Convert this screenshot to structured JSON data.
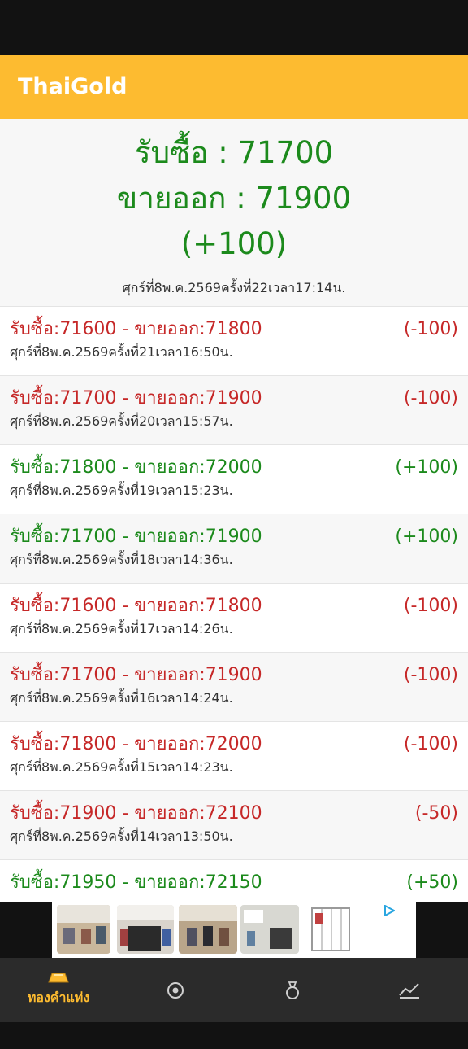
{
  "app": {
    "title": "ThaiGold"
  },
  "summary": {
    "buy_line": "รับซื้อ : 71700",
    "sell_line": "ขายออก : 71900",
    "change": "(+100)",
    "date": "ศุกร์ที่8พ.ค.2569ครั้งที่22เวลา17:14น."
  },
  "history": [
    {
      "price": "รับซื้อ:71600 - ขายออก:71800",
      "change": "(-100)",
      "date": "ศุกร์ที่8พ.ค.2569ครั้งที่21เวลา16:50น.",
      "direction": "down"
    },
    {
      "price": "รับซื้อ:71700 - ขายออก:71900",
      "change": "(-100)",
      "date": "ศุกร์ที่8พ.ค.2569ครั้งที่20เวลา15:57น.",
      "direction": "down"
    },
    {
      "price": "รับซื้อ:71800 - ขายออก:72000",
      "change": "(+100)",
      "date": "ศุกร์ที่8พ.ค.2569ครั้งที่19เวลา15:23น.",
      "direction": "up"
    },
    {
      "price": "รับซื้อ:71700 - ขายออก:71900",
      "change": "(+100)",
      "date": "ศุกร์ที่8พ.ค.2569ครั้งที่18เวลา14:36น.",
      "direction": "up"
    },
    {
      "price": "รับซื้อ:71600 - ขายออก:71800",
      "change": "(-100)",
      "date": "ศุกร์ที่8พ.ค.2569ครั้งที่17เวลา14:26น.",
      "direction": "down"
    },
    {
      "price": "รับซื้อ:71700 - ขายออก:71900",
      "change": "(-100)",
      "date": "ศุกร์ที่8พ.ค.2569ครั้งที่16เวลา14:24น.",
      "direction": "down"
    },
    {
      "price": "รับซื้อ:71800 - ขายออก:72000",
      "change": "(-100)",
      "date": "ศุกร์ที่8พ.ค.2569ครั้งที่15เวลา14:23น.",
      "direction": "down"
    },
    {
      "price": "รับซื้อ:71900 - ขายออก:72100",
      "change": "(-50)",
      "date": "ศุกร์ที่8พ.ค.2569ครั้งที่14เวลา13:50น.",
      "direction": "down"
    },
    {
      "price": "รับซื้อ:71950 - ขายออก:72150",
      "change": "(+50)",
      "date": "",
      "direction": "up"
    }
  ],
  "ad": {
    "icon": "ad-choices-icon"
  },
  "nav": {
    "active_label": "ทองคำแท่ง"
  },
  "colors": {
    "accent": "#FDBB30",
    "up": "#1c8a1c",
    "down": "#c62828"
  }
}
